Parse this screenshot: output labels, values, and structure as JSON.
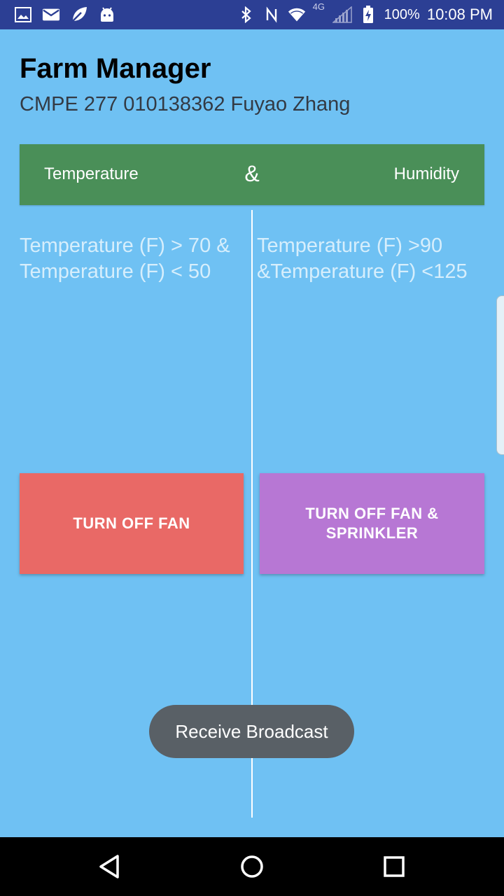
{
  "status_bar": {
    "battery_percent": "100%",
    "time": "10:08 PM",
    "network_label": "4G",
    "icons": [
      "image-icon",
      "mail-icon",
      "leaf-icon",
      "android-icon",
      "bluetooth-icon",
      "nfc-icon",
      "wifi-icon",
      "signal-icon",
      "battery-charging-icon"
    ]
  },
  "app": {
    "title": "Farm Manager",
    "subtitle": "CMPE 277 010138362 Fuyao Zhang"
  },
  "header": {
    "left": "Temperature",
    "middle": "&",
    "right": "Humidity"
  },
  "conditions": {
    "left": "Temperature (F) > 70 & Temperature (F) < 50",
    "right": "Temperature (F) >90 &Temperature (F) <125"
  },
  "buttons": {
    "turn_off_fan": "TURN OFF FAN",
    "turn_off_fan_sprinkler": "TURN OFF FAN & SPRINKLER"
  },
  "toast": {
    "message": "Receive Broadcast"
  },
  "colors": {
    "background": "#6fc1f3",
    "status_bar": "#2c3f94",
    "header_bar": "#4a8f58",
    "fan_button": "#e96966",
    "fan_sprinkler_button": "#b777d4",
    "toast": "#596066"
  },
  "nav": {
    "icons": [
      "back-icon",
      "home-icon",
      "recents-icon"
    ]
  }
}
